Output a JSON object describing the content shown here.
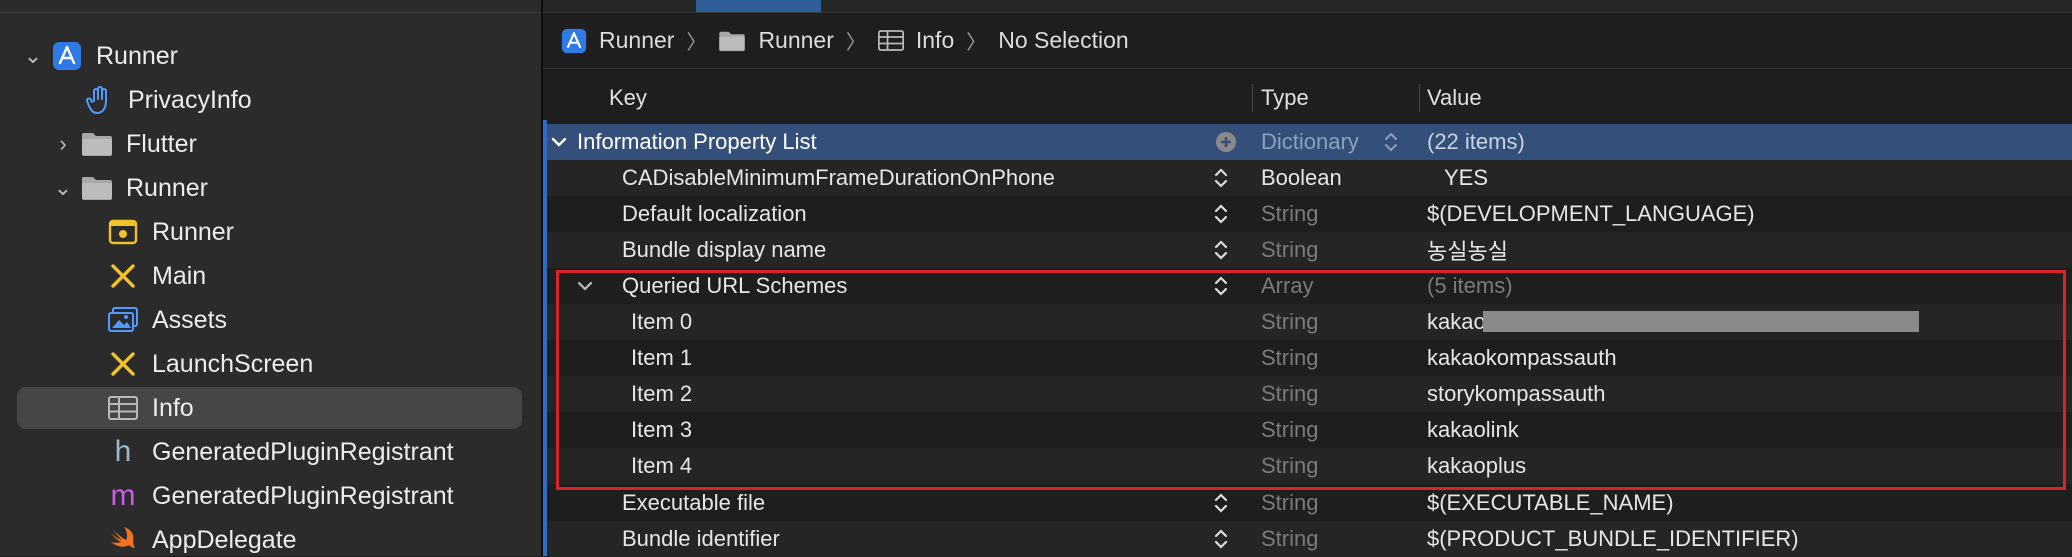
{
  "sidebar": {
    "items": [
      {
        "label": "Runner",
        "icon": "xcode-project-icon"
      },
      {
        "label": "PrivacyInfo",
        "icon": "hand-icon"
      },
      {
        "label": "Flutter",
        "icon": "folder-icon"
      },
      {
        "label": "Runner",
        "icon": "folder-icon"
      },
      {
        "label": "Runner",
        "icon": "app-target-icon"
      },
      {
        "label": "Main",
        "icon": "storyboard-icon"
      },
      {
        "label": "Assets",
        "icon": "asset-catalog-icon"
      },
      {
        "label": "LaunchScreen",
        "icon": "storyboard-icon"
      },
      {
        "label": "Info",
        "icon": "plist-table-icon"
      },
      {
        "label": "GeneratedPluginRegistrant",
        "icon": "header-h-icon"
      },
      {
        "label": "GeneratedPluginRegistrant",
        "icon": "objc-m-icon"
      },
      {
        "label": "AppDelegate",
        "icon": "swift-icon"
      }
    ],
    "selected_index": 8
  },
  "jumpbar": {
    "crumbs": [
      "Runner",
      "Runner",
      "Info",
      "No Selection"
    ]
  },
  "table": {
    "headers": {
      "key": "Key",
      "type": "Type",
      "value": "Value"
    },
    "root": {
      "key": "Information Property List",
      "type": "Dictionary",
      "value": "(22 items)"
    },
    "rows": [
      {
        "key": "CADisableMinimumFrameDurationOnPhone",
        "type": "Boolean",
        "value": "YES"
      },
      {
        "key": "Default localization",
        "type": "String",
        "value": "$(DEVELOPMENT_LANGUAGE)"
      },
      {
        "key": "Bundle display name",
        "type": "String",
        "value": "농실농실"
      },
      {
        "key": "Queried URL Schemes",
        "type": "Array",
        "value": "(5 items)"
      },
      {
        "key": "Item 0",
        "type": "String",
        "value": "kakao3"
      },
      {
        "key": "Item 1",
        "type": "String",
        "value": "kakaokompassauth"
      },
      {
        "key": "Item 2",
        "type": "String",
        "value": "storykompassauth"
      },
      {
        "key": "Item 3",
        "type": "String",
        "value": "kakaolink"
      },
      {
        "key": "Item 4",
        "type": "String",
        "value": "kakaoplus"
      },
      {
        "key": "Executable file",
        "type": "String",
        "value": "$(EXECUTABLE_NAME)"
      },
      {
        "key": "Bundle identifier",
        "type": "String",
        "value": "$(PRODUCT_BUNDLE_IDENTIFIER)"
      }
    ]
  },
  "colors": {
    "accent": "#2f6cc9",
    "highlight_box": "#d9232a",
    "selected_row": "#34507a"
  }
}
